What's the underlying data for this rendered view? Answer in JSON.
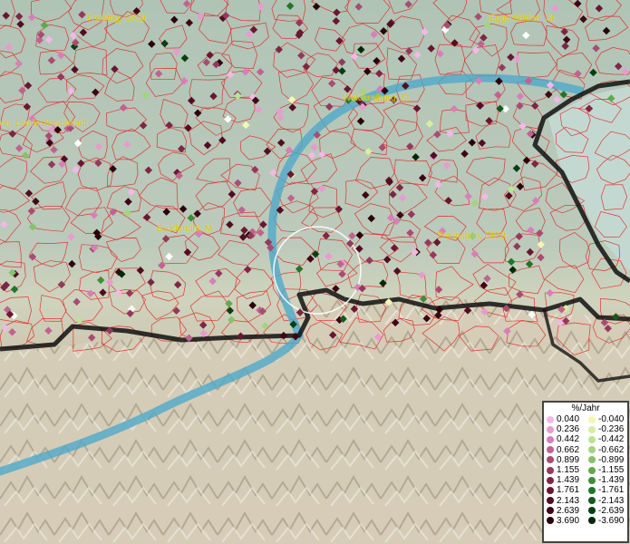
{
  "map": {
    "cities": [
      "Freising, GKSt",
      "Eggenfelden, St",
      "Waldkraiburg, St",
      "en, Landeshauptstadt",
      "Bruckmühl, M",
      "Traunstein, GKSt"
    ],
    "legend": {
      "title": "%/Jahr",
      "positive": [
        {
          "label": "0.040",
          "color": "#f2b8e6"
        },
        {
          "label": "0.236",
          "color": "#e69ccf"
        },
        {
          "label": "0.442",
          "color": "#d77fb8"
        },
        {
          "label": "0.662",
          "color": "#c0638f"
        },
        {
          "label": "0.899",
          "color": "#a84d72"
        },
        {
          "label": "1.155",
          "color": "#933a5c"
        },
        {
          "label": "1.439",
          "color": "#7d2744"
        },
        {
          "label": "1.761",
          "color": "#681830"
        },
        {
          "label": "2.143",
          "color": "#520d20"
        },
        {
          "label": "2.639",
          "color": "#3e0514"
        },
        {
          "label": "3.690",
          "color": "#2a000a"
        }
      ],
      "negative": [
        {
          "label": "-0.040",
          "color": "#f4f7b4"
        },
        {
          "label": "-0.236",
          "color": "#d7ee9e"
        },
        {
          "label": "-0.442",
          "color": "#bce394"
        },
        {
          "label": "-0.662",
          "color": "#a3d47f"
        },
        {
          "label": "-0.899",
          "color": "#86c36a"
        },
        {
          "label": "-1.155",
          "color": "#5fa94e"
        },
        {
          "label": "-1.439",
          "color": "#3f8e39"
        },
        {
          "label": "-1.761",
          "color": "#26722a"
        },
        {
          "label": "-2.143",
          "color": "#14591d"
        },
        {
          "label": "-2.639",
          "color": "#083f12"
        },
        {
          "label": "-3.690",
          "color": "#022808"
        }
      ]
    },
    "colors": {
      "lowland": "#b7c9b8",
      "alps": "#c9bfa8",
      "river": "#4fa9c9",
      "border": "#111111",
      "admin_lines": "#e21d1d",
      "lake": "#c4d8d2",
      "city_label": "#d9c400"
    }
  }
}
